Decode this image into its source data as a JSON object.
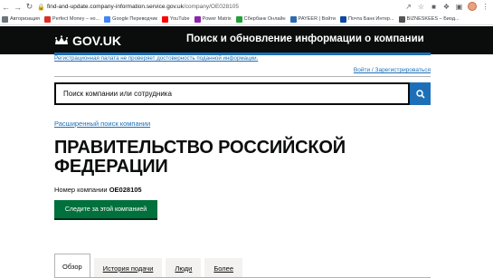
{
  "browser": {
    "url_host": "find-and-update.company-information.service.gov.uk",
    "url_path": "/company/OE028105"
  },
  "bookmarks": [
    {
      "label": "Авторизация",
      "color": "#6c757d"
    },
    {
      "label": "Perfect Money – но...",
      "color": "#d93025"
    },
    {
      "label": "Google Переводчик",
      "color": "#4285f4"
    },
    {
      "label": "YouTube",
      "color": "#ff0000"
    },
    {
      "label": "Power Matrix",
      "color": "#8e24aa"
    },
    {
      "label": "Сбербанк Онлайн",
      "color": "#21a038"
    },
    {
      "label": "PAYEER | Войти",
      "color": "#2b6cb0"
    },
    {
      "label": "Почта Банк Интер...",
      "color": "#0d47a1"
    },
    {
      "label": "BIZNESKEES – Биод...",
      "color": "#555555"
    }
  ],
  "header": {
    "logo": "GOV.UK",
    "service_name": "Поиск и обновление информации о компании"
  },
  "disclaimer": "Регистрационная палата не проверяет достоверность поданной информации.",
  "login_link": "Войти / Зарегистрироваться",
  "search": {
    "value": "Поиск компании или сотрудника"
  },
  "advanced_search": "Расширенный поиск компании",
  "company": {
    "name": "ПРАВИТЕЛЬСТВО РОССИЙСКОЙ ФЕДЕРАЦИИ",
    "number_label": "Номер компании",
    "number": "OE028105",
    "follow_button": "Следите за этой компанией"
  },
  "tabs": [
    {
      "label": "Обзор",
      "active": true
    },
    {
      "label": "История подачи",
      "active": false
    },
    {
      "label": "Люди",
      "active": false
    },
    {
      "label": "Более",
      "active": false
    }
  ],
  "colors": {
    "link": "#1d70b8",
    "header_bg": "#0b0c0c",
    "button_green": "#00703c"
  }
}
